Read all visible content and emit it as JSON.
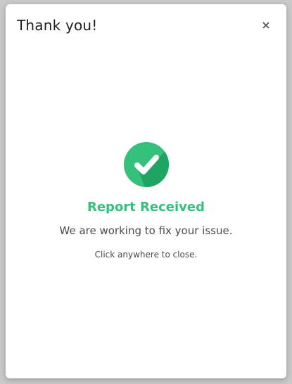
{
  "modal": {
    "title": "Thank you!",
    "close_glyph": "×",
    "close_icon": "close-icon",
    "status_icon": "check-circle-icon",
    "headline": "Report Received",
    "message": "We are working to fix your issue.",
    "hint": "Click anywhere to close."
  },
  "colors": {
    "accent": "#35c07c",
    "accent_dark": "#1ea463",
    "check": "#ffffff",
    "overlay": "#c9c9c9"
  }
}
